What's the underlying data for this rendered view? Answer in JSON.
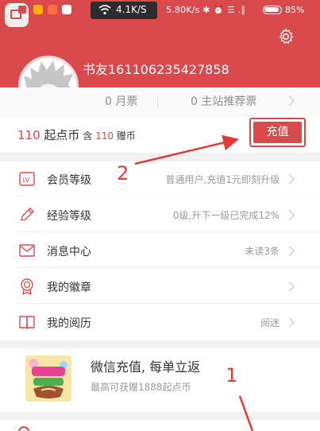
{
  "statusbar": {
    "net_speed_box": "4.1K/S",
    "right_text": "5.80K/s ✱ ⏰ ☰ .∥",
    "battery": "85%"
  },
  "profile": {
    "nickname": "书友161106235427858",
    "tickets": {
      "monthly": "0 月票",
      "recommend": "0 主站推荐票"
    }
  },
  "coins": {
    "amount": "110",
    "unit": " 起点币",
    "contains": " 含 ",
    "gift_amount": "110",
    "gift_unit": " 赠币",
    "recharge_label": "充值"
  },
  "menu": [
    {
      "icon": "lv-badge-icon",
      "label": "会员等级",
      "value": "普通用户,充值1元即刻升级"
    },
    {
      "icon": "pencil-icon",
      "label": "经验等级",
      "value": "0级,升下一级已完成12%"
    },
    {
      "icon": "envelope-icon",
      "label": "消息中心",
      "value": "未读3条"
    },
    {
      "icon": "medal-icon",
      "label": "我的徽章",
      "value": ""
    },
    {
      "icon": "book-icon",
      "label": "我的阅历",
      "value": "阅迷"
    }
  ],
  "promo": {
    "title": "微信充值, 每单立返",
    "subtitle": "最高可获赠1888起点币"
  },
  "annotations": {
    "marker_1": "1",
    "marker_2": "2"
  },
  "colors": {
    "brand_red": "#d94a4c",
    "annotation_red": "#e53935",
    "text_gray": "#9a9a9a"
  }
}
